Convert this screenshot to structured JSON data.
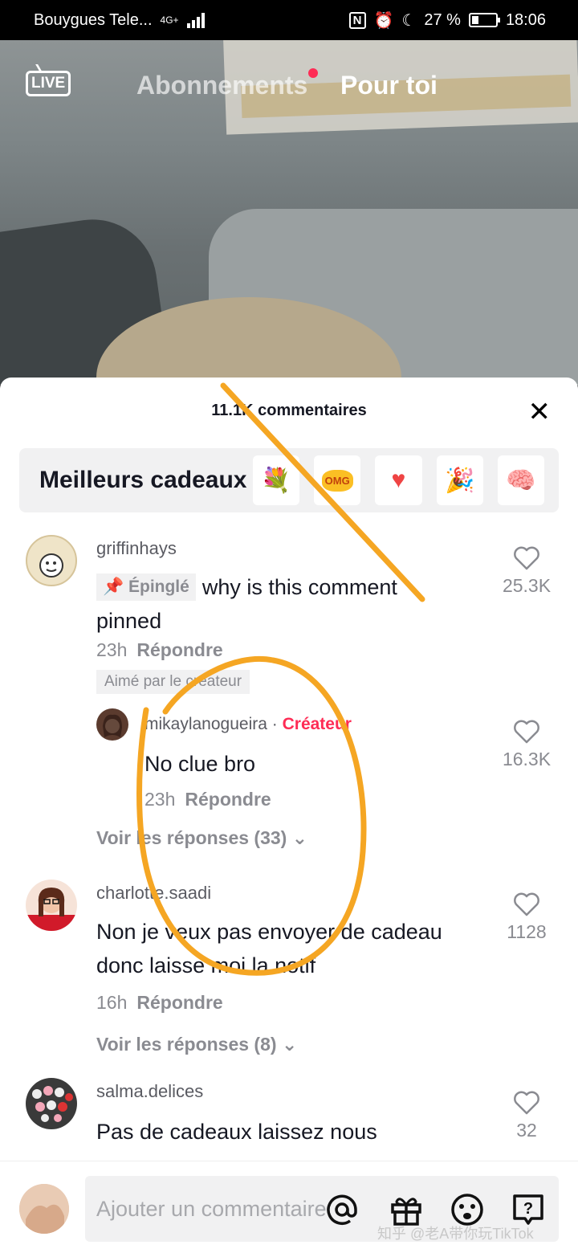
{
  "status_bar": {
    "carrier": "Bouygues Tele...",
    "network": "4G+",
    "battery": "27 %",
    "battery_level": 0.27,
    "time": "18:06"
  },
  "top_nav": {
    "live_label": "LIVE",
    "tabs": [
      "Abonnements",
      "Pour toi"
    ],
    "active_tab": "Pour toi"
  },
  "sheet": {
    "title": "11.1K commentaires",
    "gifts_title": "Meilleurs cadeaux",
    "gifts": [
      "bouquet-icon",
      "omg-icon",
      "heart-icon",
      "confetti-icon",
      "brain-icon"
    ]
  },
  "comments": [
    {
      "user": "griffinhays",
      "pinned_label": "Épinglé",
      "text": "why is this comment pinned",
      "time": "23h",
      "reply_label": "Répondre",
      "liked_by_creator": "Aimé par le créateur",
      "likes": "25.3K",
      "reply": {
        "user": "mikaylanogueira",
        "separator": "·",
        "creator_label": "Créateur",
        "text": "No clue bro",
        "time": "23h",
        "reply_label": "Répondre",
        "likes": "16.3K"
      },
      "more_replies": "Voir les réponses (33)"
    },
    {
      "user": "charlotte.saadi",
      "text": "Non je veux pas envoyer de cadeau donc laisse moi la notif",
      "time": "16h",
      "reply_label": "Répondre",
      "likes": "1128",
      "more_replies": "Voir les réponses (8)"
    },
    {
      "user": "salma.delices",
      "text": "Pas de cadeaux laissez nous",
      "likes": "32"
    }
  ],
  "bottom": {
    "placeholder": "Ajouter un commentaire...",
    "watermark": "知乎 @老A带你玩TikTok"
  },
  "colors": {
    "accent": "#fe2c55",
    "annotation": "#f5a623"
  }
}
